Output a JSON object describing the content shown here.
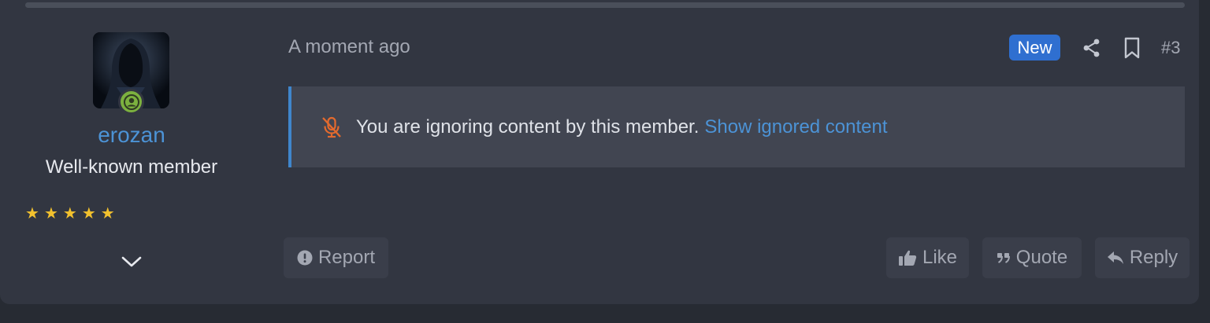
{
  "user": {
    "username": "erozan",
    "title": "Well-known member",
    "stars": [
      "★",
      "★",
      "★",
      "★",
      "★"
    ],
    "online_status": "online"
  },
  "post": {
    "timestamp": "A moment ago",
    "badge": "New",
    "number": "#3"
  },
  "ignored": {
    "message": "You are ignoring content by this member.",
    "link": "Show ignored content"
  },
  "actions": {
    "report": "Report",
    "like": "Like",
    "quote": "Quote",
    "reply": "Reply"
  },
  "colors": {
    "accent": "#4c93d6",
    "badge": "#2f6fd0",
    "online": "#7cb13f",
    "star": "#f2c12e",
    "mute_icon": "#e36a2e"
  }
}
